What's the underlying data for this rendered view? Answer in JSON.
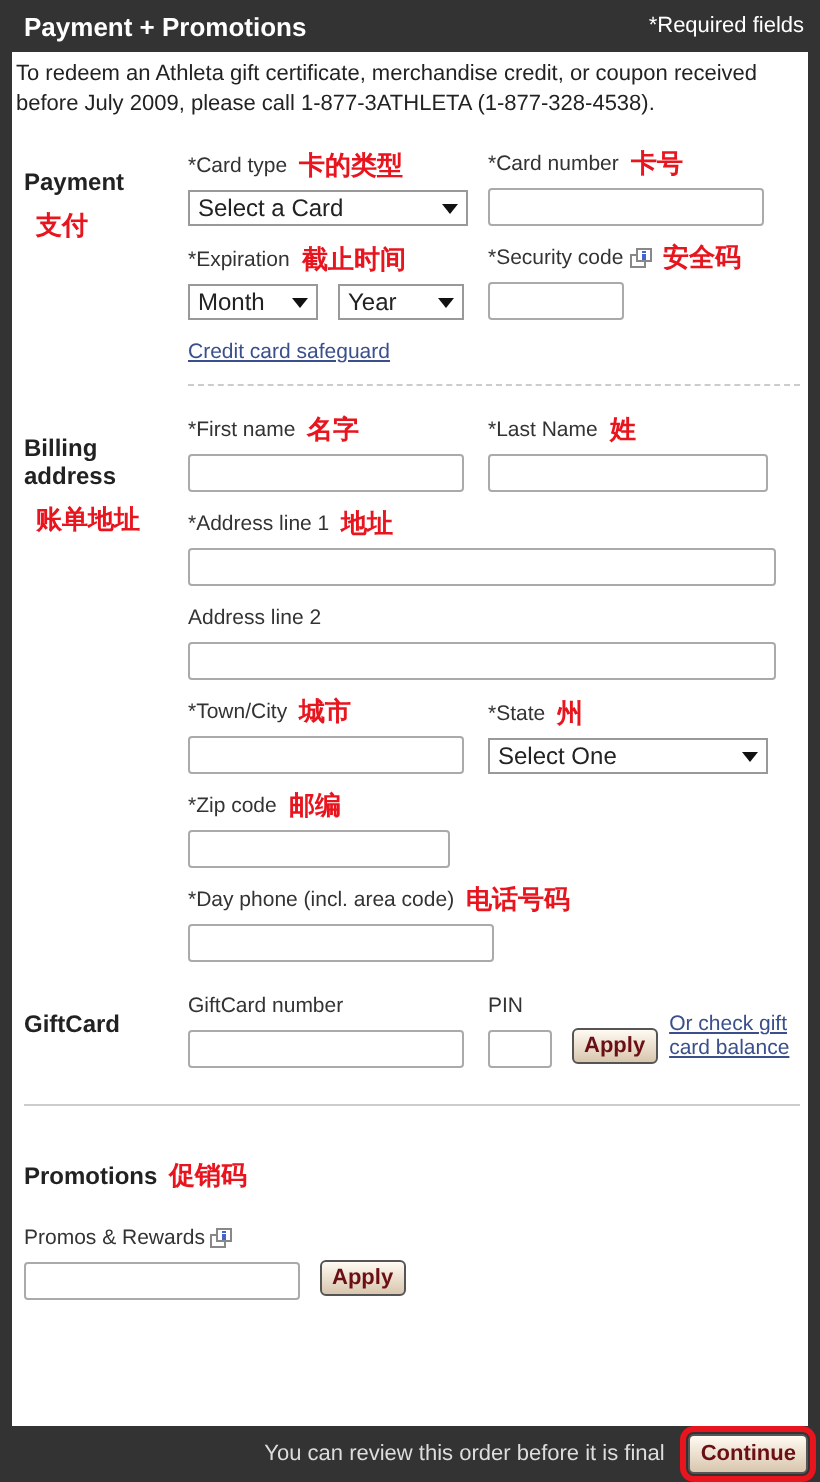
{
  "header": {
    "title": "Payment + Promotions",
    "note": "*Required fields"
  },
  "notice": "To redeem an Athleta gift certificate, merchandise credit, or coupon received before July 2009, please call 1-877-3ATHLETA (1-877-328-4538).",
  "sections": [
    {
      "kind": "columns",
      "title": "Payment",
      "annotation": "支付",
      "divider": true,
      "dashed": true,
      "link": "Credit card safeguard",
      "rows": [
        {
          "fields": [
            {
              "kind": "select",
              "label": "*Card type",
              "annotation": "卡的类型",
              "info": false,
              "values": [
                "Select a Card"
              ]
            },
            {
              "kind": "text",
              "label": "*Card number",
              "annotation": "卡号",
              "info": false
            }
          ]
        },
        {
          "fields": [
            {
              "kind": "select",
              "label": "*Expiration",
              "annotation": "截止时间",
              "info": false,
              "values": [
                "Month",
                "Year"
              ]
            },
            {
              "kind": "text",
              "label": "*Security code",
              "annotation": "安全码",
              "info": true
            }
          ]
        }
      ]
    },
    {
      "kind": "columns",
      "title": "Billing address",
      "annotation": "账单地址",
      "divider": false,
      "rows": [
        {
          "fields": [
            {
              "kind": "text",
              "label": "*First name",
              "annotation": "名字",
              "info": false
            },
            {
              "kind": "text",
              "label": "*Last Name",
              "annotation": "姓",
              "info": false
            }
          ]
        },
        {
          "fields": [
            {
              "kind": "text",
              "label": "*Address line 1",
              "annotation": "地址",
              "info": false
            }
          ]
        },
        {
          "fields": [
            {
              "kind": "text",
              "label": "Address line 2",
              "info": false
            }
          ]
        },
        {
          "fields": [
            {
              "kind": "text",
              "label": "*Town/City",
              "annotation": "城市",
              "info": false
            },
            {
              "kind": "select",
              "label": "*State",
              "annotation": "州",
              "info": false,
              "values": [
                "Select One"
              ]
            }
          ]
        },
        {
          "fields": [
            {
              "kind": "text",
              "label": "*Zip code",
              "annotation": "邮编",
              "info": false
            }
          ]
        },
        {
          "fields": [
            {
              "kind": "text",
              "label": "*Day phone (incl. area code)",
              "annotation": "电话号码",
              "info": false
            }
          ]
        }
      ]
    },
    {
      "kind": "columns",
      "title": "GiftCard",
      "divider": true,
      "dashed": false,
      "rows": [
        {
          "fields": [
            {
              "kind": "text",
              "label": "GiftCard number",
              "info": false
            },
            {
              "kind": "text",
              "label": "PIN",
              "info": false
            }
          ],
          "button": "Apply",
          "link": "Or check gift card balance"
        }
      ]
    },
    {
      "kind": "stacked",
      "title": "Promotions",
      "annotation": "促销码",
      "divider": false,
      "rows": [
        {
          "fields": [
            {
              "kind": "text",
              "label": "Promos & Rewards",
              "info": true
            }
          ],
          "button": "Apply"
        }
      ]
    }
  ],
  "footer": {
    "note": "You can review this order before it is final",
    "button": "Continue",
    "highlighted": true
  }
}
